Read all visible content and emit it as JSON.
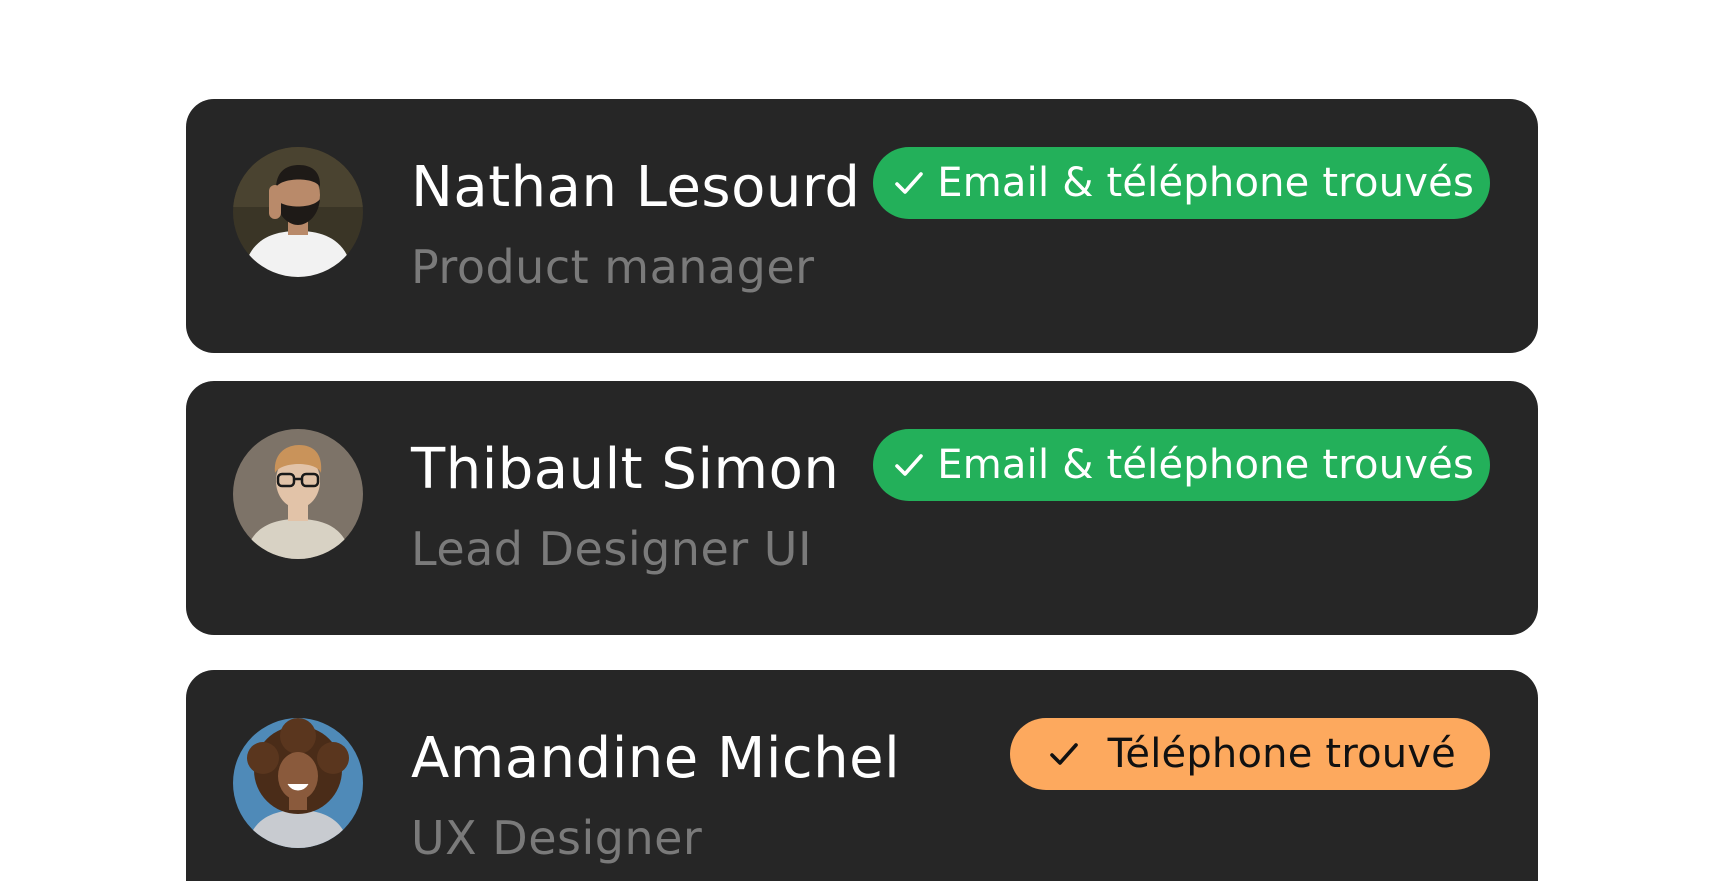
{
  "contacts": [
    {
      "name": "Nathan Lesourd",
      "role": "Product manager",
      "badge": {
        "label": "Email & téléphone trouvés",
        "status": "found-both",
        "color": "#23b05a",
        "icon": "check-icon"
      },
      "avatar": {
        "bg": "#3a3526",
        "skin": "#b98a6a",
        "hair": "#1e1a17",
        "shirt": "#f2f2f2"
      }
    },
    {
      "name": "Thibault Simon",
      "role": "Lead Designer UI",
      "badge": {
        "label": "Email & téléphone trouvés",
        "status": "found-both",
        "color": "#23b05a",
        "icon": "check-icon"
      },
      "avatar": {
        "bg": "#7d7368",
        "skin": "#e2c3a8",
        "hair": "#c9935a",
        "shirt": "#d8d2c4"
      }
    },
    {
      "name": "Amandine Michel",
      "role": "UX Designer",
      "badge": {
        "label": "Téléphone trouvé",
        "status": "found-phone",
        "color": "#fda95e",
        "icon": "check-icon"
      },
      "avatar": {
        "bg": "#4f8ab8",
        "skin": "#8a5a3c",
        "hair": "#4a2c18",
        "shirt": "#c8cbd0"
      }
    }
  ],
  "colors": {
    "page_bg": "#ffffff",
    "card_bg": "#262626",
    "name_text": "#ffffff",
    "role_text": "#7a7a7a"
  }
}
